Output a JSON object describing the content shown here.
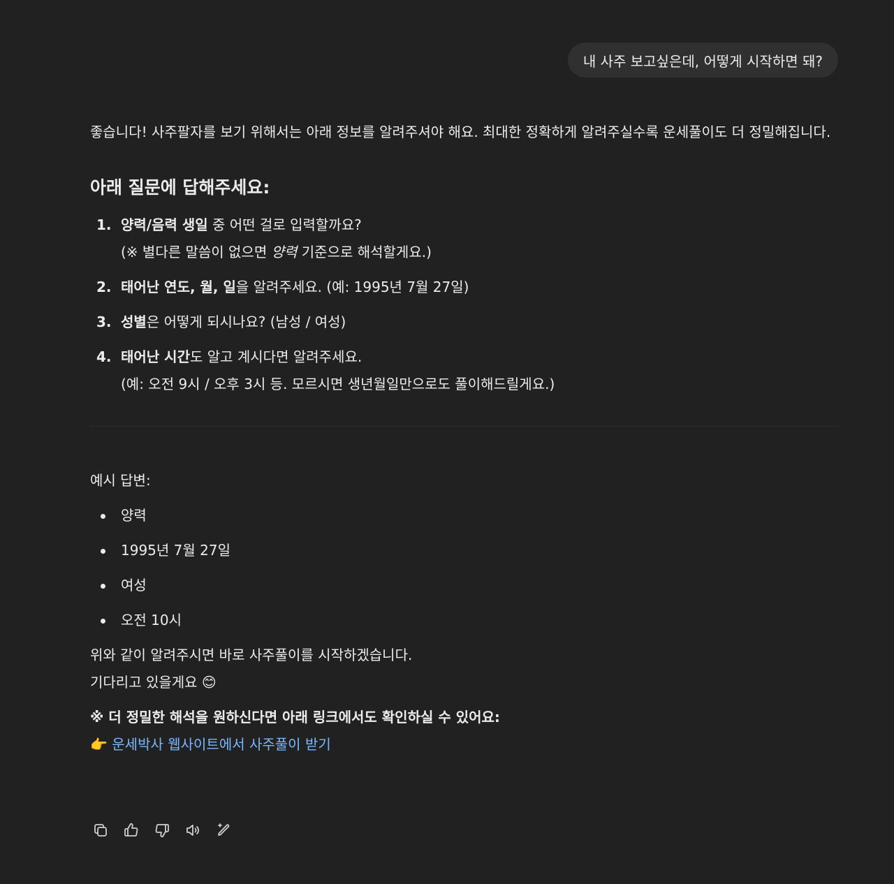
{
  "user_message": "내 사주 보고싶은데, 어떻게 시작하면 돼?",
  "assistant": {
    "intro": "좋습니다! 사주팔자를 보기 위해서는 아래 정보를 알려주셔야 해요. 최대한 정확하게 알려주실수록 운세풀이도 더 정밀해집니다.",
    "heading": "아래 질문에 답해주세요:",
    "questions": [
      {
        "num": "1.",
        "bold": "양력/음력 생일",
        "rest": " 중 어떤 걸로 입력할까요?",
        "note_prefix": "(※ 별다른 말씀이 없으면 ",
        "note_italic": "양력",
        "note_suffix": " 기준으로 해석할게요.)"
      },
      {
        "num": "2.",
        "bold": "태어난 연도, 월, 일",
        "rest": "을 알려주세요. (예: 1995년 7월 27일)"
      },
      {
        "num": "3.",
        "bold": "성별",
        "rest": "은 어떻게 되시나요? (남성 / 여성)"
      },
      {
        "num": "4.",
        "bold": "태어난 시간",
        "rest": "도 알고 계시다면 알려주세요.",
        "note": "(예: 오전 9시 / 오후 3시 등. 모르시면 생년월일만으로도 풀이해드릴게요.)"
      }
    ],
    "example_label": "예시 답변:",
    "examples": [
      "양력",
      "1995년 7월 27일",
      "여성",
      "오전 10시"
    ],
    "closing_line1": "위와 같이 알려주시면 바로 사주풀이를 시작하겠습니다.",
    "closing_line2": "기다리고 있을게요 😊",
    "note_strong": "※ 더 정밀한 해석을 원하신다면 아래 링크에서도 확인하실 수 있어요:",
    "link_emoji": "👉",
    "link_text": "운세박사 웹사이트에서 사주풀이 받기"
  },
  "actions": {
    "copy": "copy-icon",
    "thumbs_up": "thumbs-up-icon",
    "thumbs_down": "thumbs-down-icon",
    "read_aloud": "speaker-icon",
    "edit": "edit-sparkle-icon"
  }
}
